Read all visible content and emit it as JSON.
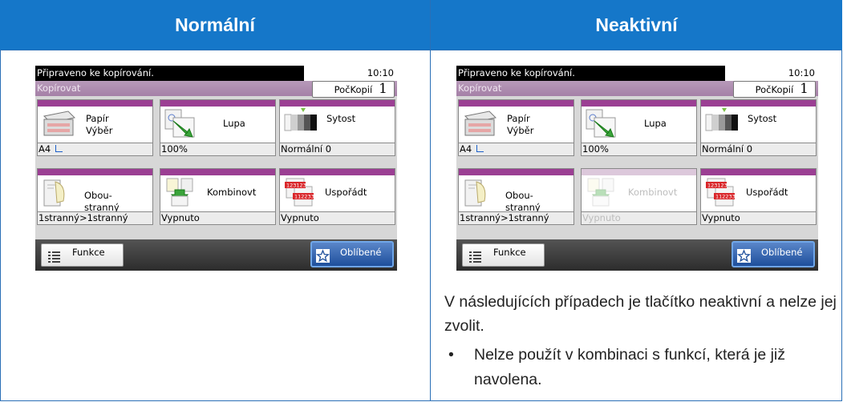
{
  "table": {
    "col_left_header": "Normální",
    "col_right_header": "Neaktivní"
  },
  "panel": {
    "status": "Připraveno ke kopírování.",
    "time": "10:10",
    "title": "Kopírovat",
    "copies_label": "PočKopií",
    "copies_value": "1",
    "tiles": [
      {
        "name1": "Papír",
        "name2": "Výběr",
        "value": "A4"
      },
      {
        "name1": "Lupa",
        "name2": "",
        "value": "100%"
      },
      {
        "name1": "Sytost",
        "name2": "",
        "value": "Normální 0"
      },
      {
        "name1": "Obou-",
        "name2": "stranný",
        "value": "1stranný>1stranný"
      },
      {
        "name1": "Kombinovt",
        "name2": "",
        "value": "Vypnuto"
      },
      {
        "name1": "Uspořádt",
        "name2": "",
        "value": "Vypnuto"
      }
    ],
    "funkce": "Funkce",
    "oblibene": "Oblíbené",
    "sort_badge_1": "123123",
    "sort_badge_2": "112233"
  },
  "note": {
    "paragraph": "V následujících případech je tlačítko neaktivní a nelze jej zvolit.",
    "bullet_char": "•",
    "bullet": "Nelze použít v kombinaci s funkcí, která je již navolena."
  },
  "colors": {
    "header_blue": "#1577c9",
    "tile_accent": "#9b3f93",
    "title_bar": "#a580a7",
    "favorites_blue": "#1e4f9c"
  }
}
